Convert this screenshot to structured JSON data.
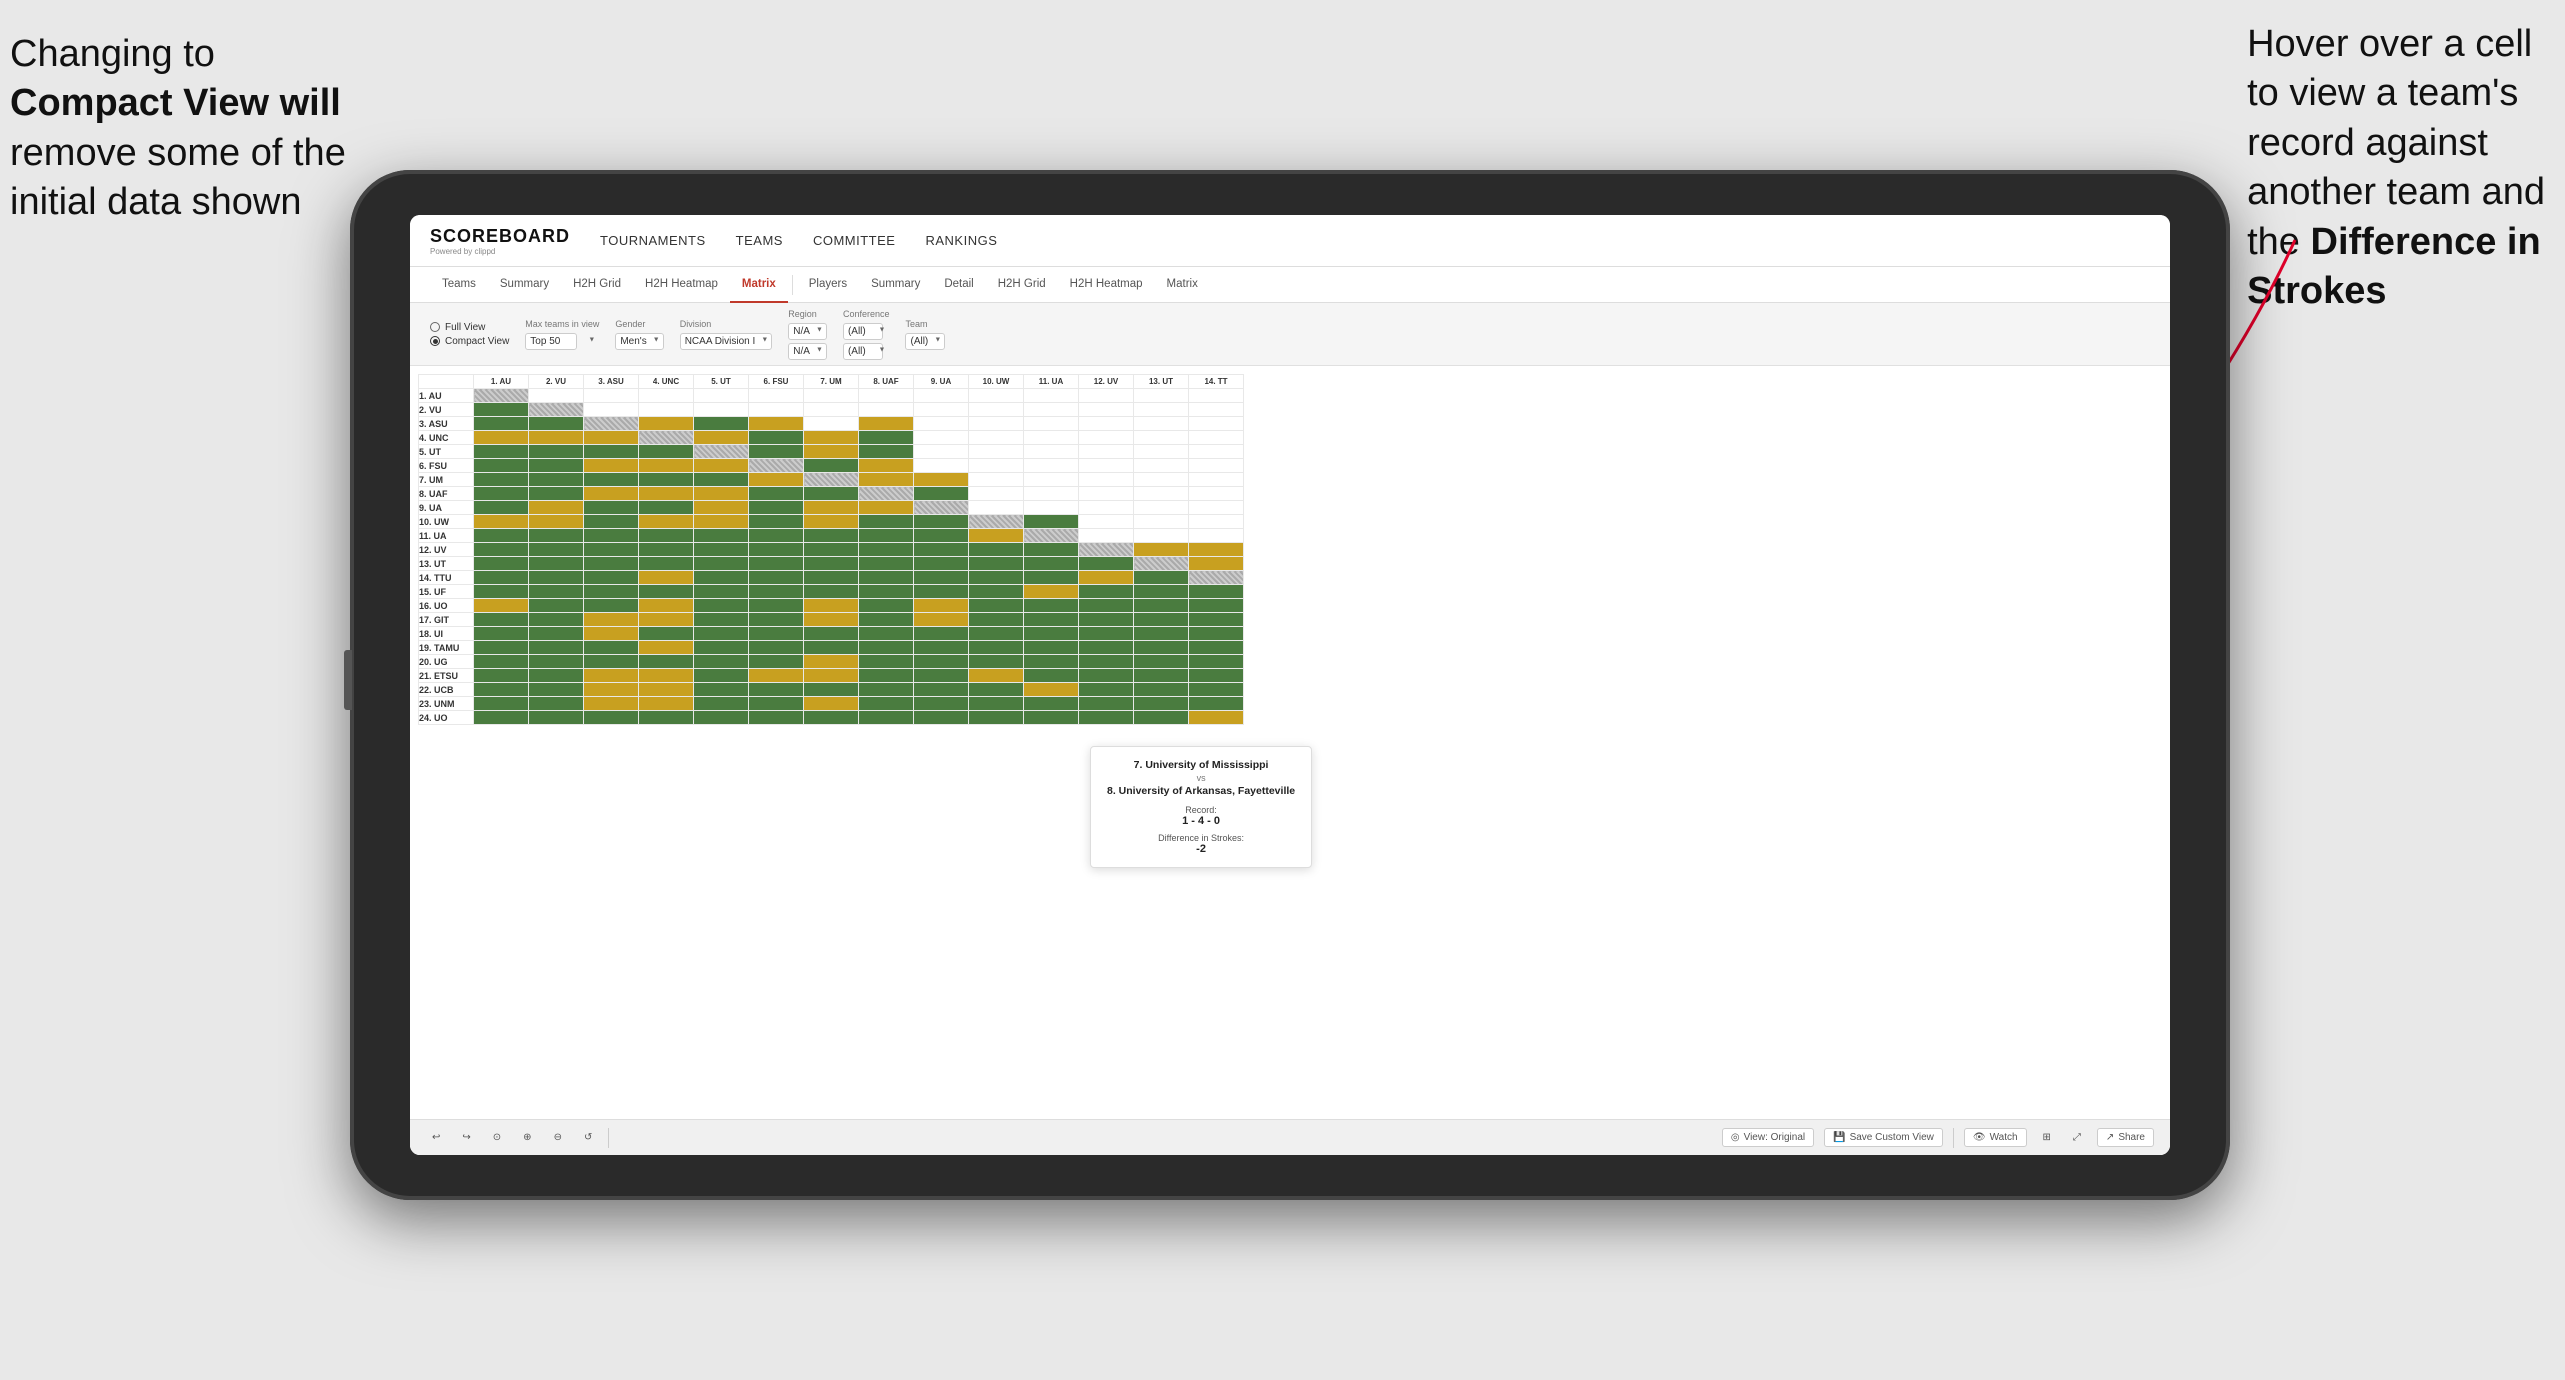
{
  "annotations": {
    "left_text_line1": "Changing to",
    "left_text_line2": "Compact View",
    "left_text_line3": "will",
    "left_text_line4": "remove some of the",
    "left_text_line5": "initial data shown",
    "right_text_line1": "Hover over a cell",
    "right_text_line2": "to view a team's",
    "right_text_line3": "record against",
    "right_text_line4": "another team and",
    "right_text_line5": "the",
    "right_text_line6": "Difference in",
    "right_text_line7": "Strokes"
  },
  "header": {
    "logo": "SCOREBOARD",
    "logo_sub": "Powered by clippd",
    "nav_items": [
      "TOURNAMENTS",
      "TEAMS",
      "COMMITTEE",
      "RANKINGS"
    ]
  },
  "sub_tabs_left": [
    {
      "label": "Teams",
      "active": false
    },
    {
      "label": "Summary",
      "active": false
    },
    {
      "label": "H2H Grid",
      "active": false
    },
    {
      "label": "H2H Heatmap",
      "active": false
    },
    {
      "label": "Matrix",
      "active": true
    }
  ],
  "sub_tabs_right": [
    {
      "label": "Players",
      "active": false
    },
    {
      "label": "Summary",
      "active": false
    },
    {
      "label": "Detail",
      "active": false
    },
    {
      "label": "H2H Grid",
      "active": false
    },
    {
      "label": "H2H Heatmap",
      "active": false
    },
    {
      "label": "Matrix",
      "active": false
    }
  ],
  "filters": {
    "view_options": [
      "Full View",
      "Compact View"
    ],
    "selected_view": "Compact View",
    "max_teams_label": "Max teams in view",
    "max_teams_value": "Top 50",
    "gender_label": "Gender",
    "gender_value": "Men's",
    "division_label": "Division",
    "division_value": "NCAA Division I",
    "region_label": "Region",
    "region_value": "N/A",
    "region_value2": "N/A",
    "conference_label": "Conference",
    "conference_value": "(All)",
    "conference_value2": "(All)",
    "team_label": "Team",
    "team_value": "(All)"
  },
  "col_headers": [
    "1. AU",
    "2. VU",
    "3. ASU",
    "4. UNC",
    "5. UT",
    "6. FSU",
    "7. UM",
    "8. UAF",
    "9. UA",
    "10. UW",
    "11. UA",
    "12. UV",
    "13. UT",
    "14. TT"
  ],
  "row_headers": [
    "1. AU",
    "2. VU",
    "3. ASU",
    "4. UNC",
    "5. UT",
    "6. FSU",
    "7. UM",
    "8. UAF",
    "9. UA",
    "10. UW",
    "11. UA",
    "12. UV",
    "13. UT",
    "14. TTU",
    "15. UF",
    "16. UO",
    "17. GIT",
    "18. UI",
    "19. TAMU",
    "20. UG",
    "21. ETSU",
    "22. UCB",
    "23. UNM",
    "24. UO"
  ],
  "tooltip": {
    "team1": "7. University of Mississippi",
    "vs": "vs",
    "team2": "8. University of Arkansas, Fayetteville",
    "record_label": "Record:",
    "record_value": "1 - 4 - 0",
    "diff_label": "Difference in Strokes:",
    "diff_value": "-2"
  },
  "toolbar": {
    "undo": "↩",
    "redo": "↪",
    "btn1": "⊙",
    "btn2": "⊕",
    "btn3": "⊖",
    "btn4": "↺",
    "view_original": "View: Original",
    "save_custom": "Save Custom View",
    "watch": "Watch",
    "share": "Share"
  }
}
